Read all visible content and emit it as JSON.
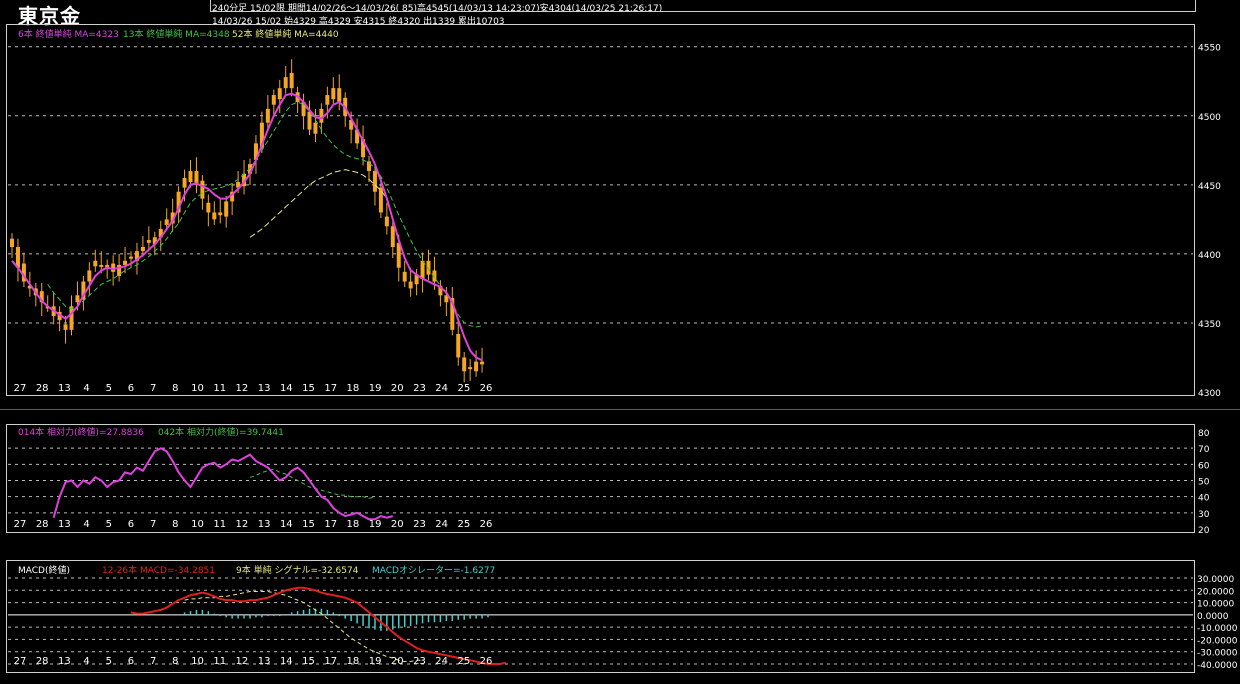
{
  "header": {
    "title": "東京金",
    "line1": "240分足 15/02限 期間14/02/26〜14/03/26( 85)高4545(14/03/13 14:23:07)安4304(14/03/25 21:26:17)",
    "line2": "14/03/26 15/02 始4329 高4329 安4315 終4320 出1339 累出10703"
  },
  "colors": {
    "candle": "#f5a623",
    "ma_short": "#e040e0",
    "ma_mid": "#3ec43e",
    "ma_long": "#e8e878",
    "rsi_short": "#e040e0",
    "rsi_long": "#3ec43e",
    "macd": "#e02020",
    "signal": "#e8e878",
    "osc": "#40d0d0",
    "grid": "#bbbbbb"
  },
  "chart_data": [
    {
      "type": "candlestick",
      "legend": [
        {
          "text": "6本 終値単純 MA=4323",
          "color": "#e040e0"
        },
        {
          "text": "13本 終値単純 MA=4348",
          "color": "#3ec43e"
        },
        {
          "text": "52本 終値単純 MA=4440",
          "color": "#e8e878"
        }
      ],
      "ylim": [
        4300,
        4565
      ],
      "yticks": [
        4300,
        4350,
        4400,
        4450,
        4500,
        4550
      ],
      "x_day_labels": [
        "27",
        "28",
        "13",
        "4",
        "5",
        "6",
        "7",
        "8",
        "10",
        "11",
        "12",
        "13",
        "14",
        "15",
        "17",
        "18",
        "19",
        "20",
        "23",
        "24",
        "25",
        "26"
      ],
      "close": [
        4405,
        4390,
        4380,
        4375,
        4370,
        4365,
        4362,
        4355,
        4352,
        4345,
        4362,
        4370,
        4380,
        4388,
        4395,
        4392,
        4390,
        4387,
        4392,
        4395,
        4398,
        4402,
        4405,
        4410,
        4412,
        4418,
        4425,
        4430,
        4445,
        4455,
        4460,
        4450,
        4440,
        4430,
        4425,
        4430,
        4438,
        4445,
        4452,
        4458,
        4465,
        4480,
        4495,
        4505,
        4515,
        4520,
        4528,
        4520,
        4510,
        4500,
        4490,
        4495,
        4505,
        4515,
        4520,
        4510,
        4500,
        4490,
        4480,
        4470,
        4460,
        4445,
        4430,
        4420,
        4405,
        4390,
        4380,
        4375,
        4385,
        4395,
        4385,
        4380,
        4370,
        4365,
        4345,
        4325,
        4315,
        4318,
        4322,
        4320
      ],
      "ma_short": [
        4395,
        4390,
        4384,
        4378,
        4372,
        4366,
        4362,
        4359,
        4356,
        4353,
        4357,
        4362,
        4370,
        4377,
        4384,
        4388,
        4390,
        4389,
        4390,
        4391,
        4393,
        4396,
        4399,
        4403,
        4407,
        4412,
        4418,
        4424,
        4433,
        4443,
        4450,
        4451,
        4449,
        4447,
        4443,
        4440,
        4440,
        4443,
        4447,
        4452,
        4458,
        4468,
        4479,
        4490,
        4500,
        4508,
        4515,
        4516,
        4514,
        4510,
        4504,
        4499,
        4498,
        4502,
        4508,
        4510,
        4506,
        4498,
        4490,
        4482,
        4474,
        4465,
        4453,
        4440,
        4425,
        4410,
        4397,
        4388,
        4385,
        4382,
        4380,
        4378,
        4376,
        4372,
        4365,
        4352,
        4340,
        4330,
        4325,
        4323
      ],
      "ma_mid": [
        null,
        null,
        null,
        null,
        null,
        null,
        4378,
        4372,
        4367,
        4362,
        4360,
        4362,
        4366,
        4370,
        4374,
        4378,
        4380,
        4382,
        4385,
        4388,
        4390,
        4392,
        4395,
        4398,
        4402,
        4406,
        4411,
        4417,
        4422,
        4430,
        4437,
        4441,
        4444,
        4446,
        4447,
        4448,
        4449,
        4451,
        4454,
        4458,
        4462,
        4468,
        4475,
        4482,
        4489,
        4496,
        4503,
        4508,
        4510,
        4508,
        4503,
        4497,
        4490,
        4484,
        4479,
        4475,
        4472,
        4470,
        4469,
        4468,
        4466,
        4462,
        4456,
        4448,
        4438,
        4428,
        4419,
        4410,
        4402,
        4395,
        4389,
        4383,
        4377,
        4371,
        4364,
        4356,
        4350,
        4348,
        4347,
        4348
      ],
      "ma_long": [
        null,
        null,
        null,
        null,
        null,
        null,
        null,
        null,
        null,
        null,
        null,
        null,
        null,
        null,
        null,
        null,
        null,
        null,
        null,
        null,
        null,
        null,
        null,
        null,
        null,
        null,
        null,
        null,
        null,
        null,
        null,
        null,
        null,
        null,
        null,
        null,
        null,
        null,
        null,
        null,
        4412,
        4415,
        4418,
        4422,
        4426,
        4430,
        4434,
        4438,
        4442,
        4446,
        4450,
        4453,
        4455,
        4457,
        4459,
        4460,
        4461,
        4460,
        4459,
        4457,
        4454,
        4450,
        4446,
        4440
      ],
      "current_price": 4320
    },
    {
      "type": "line",
      "legend": [
        {
          "text": "014本 相対力(終値)=27.8836",
          "color": "#e040e0"
        },
        {
          "text": "042本 相対力(終値)=39.7441",
          "color": "#3ec43e"
        }
      ],
      "ylim": [
        20,
        80
      ],
      "yticks": [
        20,
        30,
        40,
        50,
        60,
        70,
        80
      ],
      "series": [
        {
          "name": "014本 相対力(終値)",
          "start": 7,
          "values": [
            27,
            40,
            49,
            50,
            46,
            50,
            48,
            52,
            50,
            46,
            49,
            50,
            55,
            54,
            58,
            56,
            62,
            68,
            70,
            68,
            62,
            55,
            50,
            46,
            52,
            58,
            60,
            61,
            58,
            60,
            63,
            62,
            64,
            66,
            62,
            60,
            58,
            54,
            50,
            52,
            56,
            58,
            55,
            50,
            45,
            40,
            38,
            33,
            30,
            28,
            29,
            30,
            28,
            26,
            26,
            28,
            27,
            28
          ]
        },
        {
          "name": "042本 相対力(終値)",
          "start": 40,
          "values": [
            52,
            53,
            55,
            56,
            57,
            55,
            54,
            52,
            50,
            48,
            46,
            45,
            44,
            43,
            42,
            41,
            41,
            40,
            40,
            40,
            39,
            40
          ]
        }
      ]
    },
    {
      "type": "line_bar",
      "legend": [
        {
          "text": "MACD(終値)",
          "color": "#ffffff"
        },
        {
          "text": "12-26本 MACD=-34.2851",
          "color": "#e02020"
        },
        {
          "text": "9本 単純 シグナル=-32.6574",
          "color": "#e8e878"
        },
        {
          "text": "MACDオシレーター=-1.6277",
          "color": "#40d0d0"
        }
      ],
      "ylim": [
        -40,
        30
      ],
      "yticks": [
        "30.0000",
        "20.0000",
        "10.0000",
        "0.0000",
        "-10.0000",
        "-20.0000",
        "-30.0000",
        "-40.0000"
      ],
      "macd_start": 20,
      "macd": [
        2,
        1,
        1,
        2,
        3,
        4,
        6,
        9,
        12,
        14,
        16,
        17,
        18,
        17,
        15,
        13,
        12,
        12,
        11,
        11,
        12,
        12,
        13,
        14,
        16,
        18,
        20,
        21,
        22,
        22,
        21,
        20,
        18,
        17,
        16,
        15,
        14,
        12,
        10,
        6,
        2,
        -2,
        -6,
        -10,
        -14,
        -18,
        -21,
        -24,
        -27,
        -29,
        -30,
        -31,
        -32,
        -33,
        -34,
        -35,
        -36,
        -37,
        -38,
        -39,
        -40,
        -40,
        -40,
        -39
      ],
      "signal_start": 29,
      "signal": [
        12,
        13,
        13,
        14,
        14,
        14,
        15,
        15,
        16,
        17,
        18,
        19,
        19,
        19,
        19,
        18,
        17,
        16,
        14,
        12,
        10,
        7,
        4,
        1,
        -3,
        -7,
        -11,
        -15,
        -19,
        -22,
        -25,
        -28,
        -30,
        -32,
        -34,
        -35,
        -37,
        -38,
        -38,
        -37,
        -37
      ],
      "osc_start": 29,
      "osc": [
        2,
        3,
        4,
        4,
        3,
        1,
        -1,
        -2,
        -3,
        -3,
        -3,
        -3,
        -2,
        -2,
        -1,
        -1,
        -1,
        0,
        2,
        3,
        4,
        5,
        5,
        5,
        4,
        2,
        -1,
        -3,
        -5,
        -7,
        -9,
        -11,
        -12,
        -13,
        -13,
        -12,
        -11,
        -10,
        -9,
        -8,
        -7,
        -6,
        -6,
        -6,
        -5,
        -5,
        -4,
        -4,
        -3,
        -3,
        -3,
        -2
      ]
    }
  ]
}
